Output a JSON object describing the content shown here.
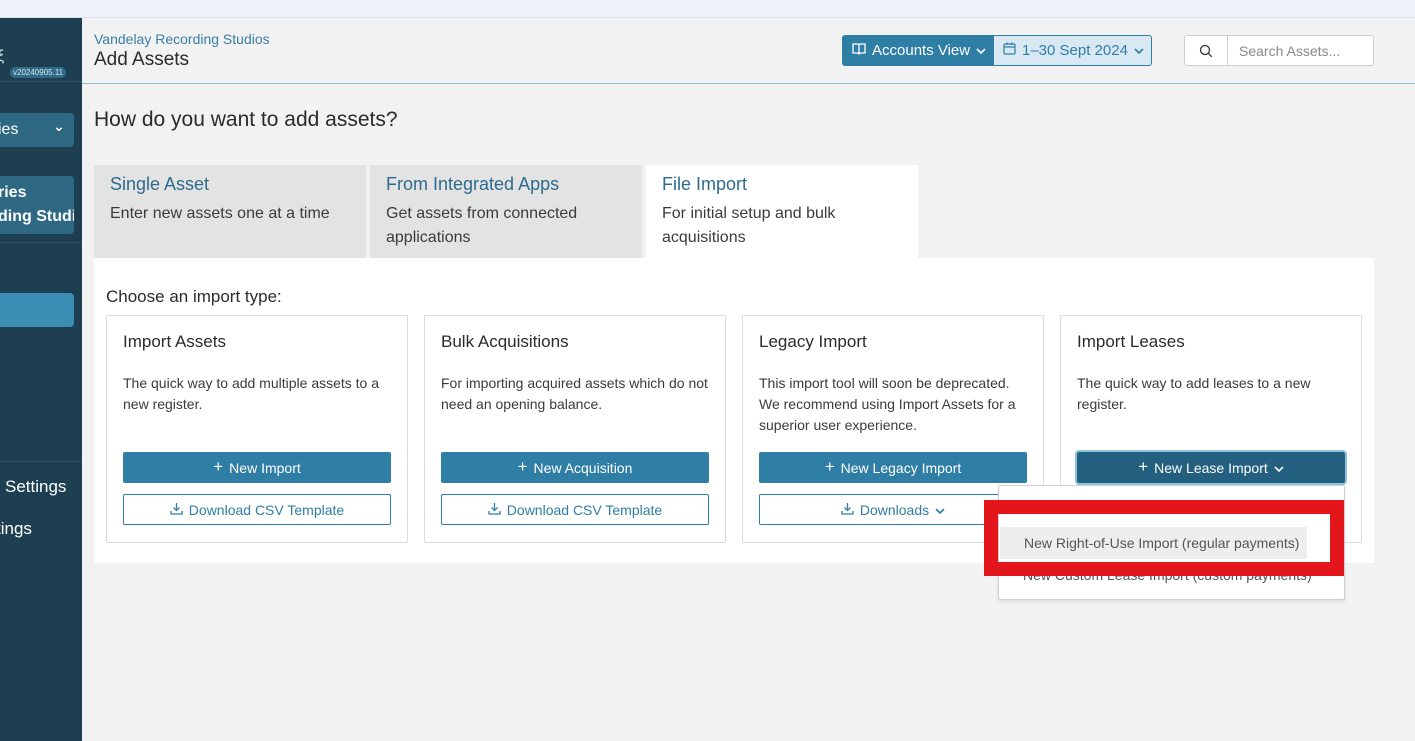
{
  "browser": {
    "url_fragment": "…"
  },
  "sidebar": {
    "version": "v20240905.11",
    "select_label": "ies",
    "org_line1": "ries",
    "org_line2": "ding Studio",
    "settings_1": "Settings",
    "settings_2": "tings"
  },
  "header": {
    "org_name": "Vandelay Recording Studios",
    "page_title": "Add Assets",
    "view_label": "Accounts View",
    "date_range": "1–30 Sept 2024",
    "search_placeholder": "Search Assets..."
  },
  "main": {
    "question": "How do you want to add assets?",
    "tabs": [
      {
        "title": "Single Asset",
        "desc": "Enter new assets one at a time"
      },
      {
        "title": "From Integrated Apps",
        "desc": "Get assets from connected applications"
      },
      {
        "title": "File Import",
        "desc": "For initial setup and bulk acquisitions",
        "active": true
      }
    ],
    "panel_title": "Choose an import type:",
    "cards": [
      {
        "title": "Import Assets",
        "desc": "The quick way to add multiple assets to a new register.",
        "primary": "New Import",
        "secondary": "Download CSV Template"
      },
      {
        "title": "Bulk Acquisitions",
        "desc": "For importing acquired assets which do not need an opening balance.",
        "primary": "New Acquisition",
        "secondary": "Download CSV Template"
      },
      {
        "title": "Legacy Import",
        "desc": "This import tool will soon be deprecated. We recommend using Import Assets for a superior user experience.",
        "primary": "New Legacy Import",
        "secondary": "Downloads"
      },
      {
        "title": "Import Leases",
        "desc": "The quick way to add leases to a new register.",
        "primary": "New Lease Import"
      }
    ],
    "lease_menu": [
      "New Right-of-Use Import (regular payments)",
      "New Custom Lease Import (custom payments)"
    ]
  },
  "colors": {
    "primary": "#2e7ea6",
    "sidebar": "#1e3f52",
    "highlight": "#e3161c"
  }
}
